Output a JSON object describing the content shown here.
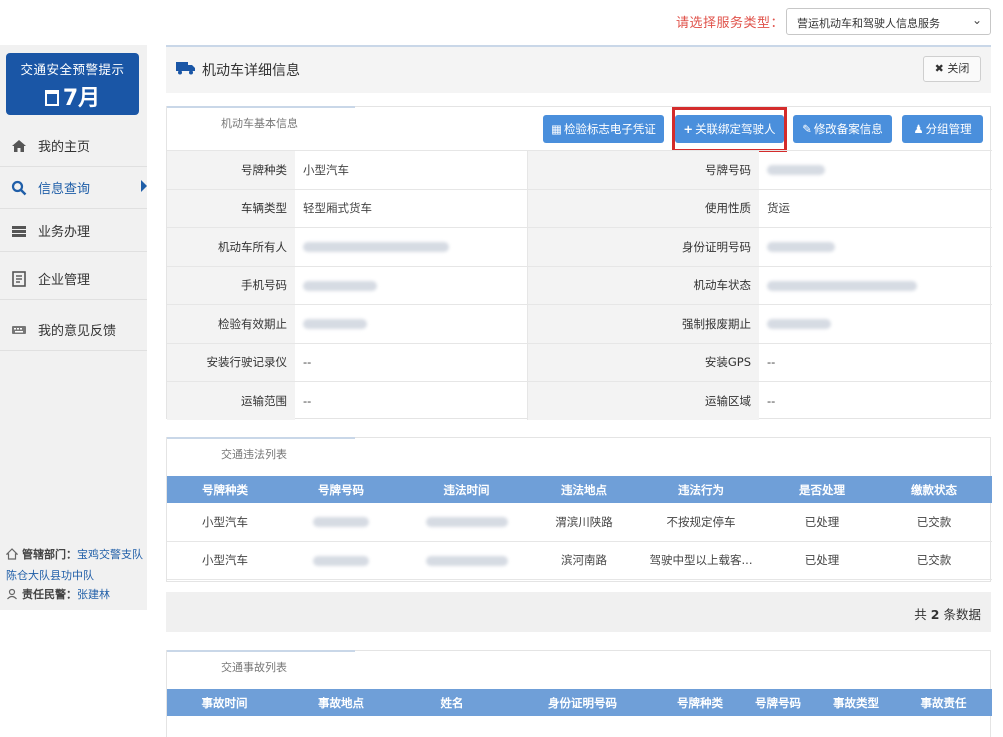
{
  "service": {
    "label": "请选择服务类型：",
    "selected": "营运机动车和驾驶人信息服务"
  },
  "sidebar": {
    "alert_title": "交通安全预警提示",
    "alert_month": "7月",
    "items": [
      {
        "label": "我的主页",
        "icon": "home-icon"
      },
      {
        "label": "信息查询",
        "icon": "search-icon"
      },
      {
        "label": "业务办理",
        "icon": "tray-icon"
      },
      {
        "label": "企业管理",
        "icon": "document-icon"
      },
      {
        "label": "我的意见反馈",
        "icon": "keyboard-icon"
      }
    ],
    "dept_label": "管辖部门：",
    "dept_value": "宝鸡交警支队陈仓大队县功中队",
    "police_label": "责任民警：",
    "police_value": "张建林"
  },
  "page": {
    "title": "机动车详细信息",
    "close_label": "关闭"
  },
  "basic": {
    "tab": "机动车基本信息",
    "buttons": [
      "检验标志电子凭证",
      "关联绑定驾驶人",
      "修改备案信息",
      "分组管理"
    ],
    "rows": [
      {
        "l1": "号牌种类",
        "v1": "小型汽车",
        "l2": "号牌号码",
        "v2": ""
      },
      {
        "l1": "车辆类型",
        "v1": "轻型厢式货车",
        "l2": "使用性质",
        "v2": "货运"
      },
      {
        "l1": "机动车所有人",
        "v1": "",
        "l2": "身份证明号码",
        "v2": ""
      },
      {
        "l1": "手机号码",
        "v1": "",
        "l2": "机动车状态",
        "v2": ""
      },
      {
        "l1": "检验有效期止",
        "v1": "",
        "l2": "强制报废期止",
        "v2": ""
      },
      {
        "l1": "安装行驶记录仪",
        "v1": "--",
        "l2": "安装GPS",
        "v2": "--"
      },
      {
        "l1": "运输范围",
        "v1": "--",
        "l2": "运输区域",
        "v2": "--"
      }
    ]
  },
  "violations": {
    "tab": "交通违法列表",
    "headers": [
      "号牌种类",
      "号牌号码",
      "违法时间",
      "违法地点",
      "违法行为",
      "是否处理",
      "缴款状态"
    ],
    "rows": [
      {
        "type": "小型汽车",
        "loc": "渭滨川陕路",
        "act": "不按规定停车",
        "handled": "已处理",
        "paid": "已交款"
      },
      {
        "type": "小型汽车",
        "loc": "滨河南路",
        "act": "驾驶中型以上载客...",
        "handled": "已处理",
        "paid": "已交款"
      }
    ],
    "total_prefix": "共",
    "total": "2",
    "total_suffix": "条数据"
  },
  "accidents": {
    "tab": "交通事故列表",
    "headers": [
      "事故时间",
      "事故地点",
      "姓名",
      "身份证明号码",
      "号牌种类",
      "号牌号码",
      "事故类型",
      "事故责任"
    ]
  },
  "colors": {
    "accent_blue": "#4a8fdc",
    "nav_blue": "#1a56a6",
    "highlight_red": "#d42c2c",
    "label_red": "#e0524a"
  }
}
